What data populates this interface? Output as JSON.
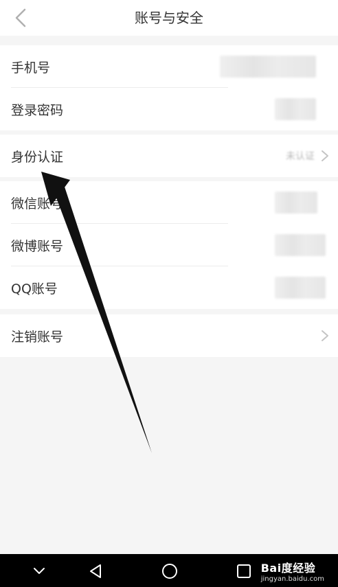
{
  "header": {
    "title": "账号与安全",
    "back_icon": "chevron-left-icon"
  },
  "groups": [
    {
      "rows": [
        {
          "label": "手机号"
        },
        {
          "label": "登录密码"
        }
      ]
    },
    {
      "rows": [
        {
          "label": "身份认证",
          "value": "未认证"
        }
      ]
    },
    {
      "rows": [
        {
          "label": "微信账号"
        },
        {
          "label": "微博账号"
        },
        {
          "label": "QQ账号"
        }
      ]
    },
    {
      "rows": [
        {
          "label": "注销账号"
        }
      ]
    }
  ],
  "navbar": {
    "icons": [
      "chevron-down-icon",
      "back-triangle-icon",
      "home-circle-icon",
      "recents-square-icon"
    ]
  },
  "watermark": {
    "logo_text": "Bai度经验",
    "url": "jingyan.baidu.com"
  },
  "colors": {
    "background": "#f5f5f5",
    "card": "#ffffff",
    "text": "#333333",
    "muted": "#b8b8b8",
    "navbar": "#000000",
    "arrow": "#111111"
  }
}
